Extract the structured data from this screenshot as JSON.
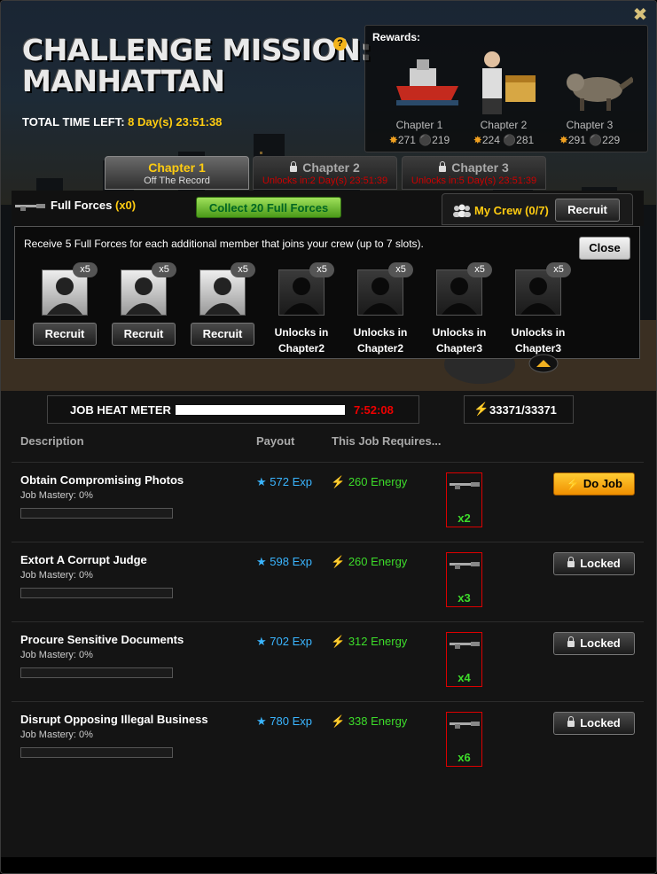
{
  "window": {
    "close_icon": "close-x-icon"
  },
  "header": {
    "title_line1": "CHALLENGE MISSION:",
    "title_line2": "MANHATTAN",
    "help_icon": "?",
    "time_left_label": "TOTAL TIME LEFT:",
    "time_left_value": "8 Day(s) 23:51:38"
  },
  "rewards": {
    "label": "Rewards:",
    "items": [
      {
        "chapter": "Chapter 1",
        "attack": "271",
        "defense": "219"
      },
      {
        "chapter": "Chapter 2",
        "attack": "224",
        "defense": "281"
      },
      {
        "chapter": "Chapter 3",
        "attack": "291",
        "defense": "229"
      }
    ]
  },
  "tabs": [
    {
      "title": "Chapter 1",
      "subtitle": "Off The Record",
      "active": true
    },
    {
      "title": "Chapter 2",
      "subtitle": "Unlocks in:2 Day(s) 23:51:39",
      "locked": true
    },
    {
      "title": "Chapter 3",
      "subtitle": "Unlocks in:5 Day(s) 23:51:39",
      "locked": true
    }
  ],
  "full_forces": {
    "label": "Full Forces",
    "count": "(x0)",
    "collect_button": "Collect 20 Full Forces"
  },
  "my_crew": {
    "label": "My Crew (0/7)",
    "recruit_button": "Recruit"
  },
  "crew_panel": {
    "message": "Receive 5 Full Forces for each additional member that joins your crew (up to 7 slots).",
    "close_button": "Close",
    "slots": [
      {
        "badge": "x5",
        "action": "Recruit",
        "unlocked": true
      },
      {
        "badge": "x5",
        "action": "Recruit",
        "unlocked": true
      },
      {
        "badge": "x5",
        "action": "Recruit",
        "unlocked": true
      },
      {
        "badge": "x5",
        "line1": "Unlocks in",
        "line2": "Chapter2"
      },
      {
        "badge": "x5",
        "line1": "Unlocks in",
        "line2": "Chapter2"
      },
      {
        "badge": "x5",
        "line1": "Unlocks in",
        "line2": "Chapter3"
      },
      {
        "badge": "x5",
        "line1": "Unlocks in",
        "line2": "Chapter3"
      }
    ]
  },
  "heat_meter": {
    "label": "JOB HEAT METER",
    "time": "7:52:08",
    "fill_fraction": 1.0
  },
  "energy": {
    "value": "33371/33371"
  },
  "columns": {
    "description": "Description",
    "payout": "Payout",
    "requires": "This Job Requires..."
  },
  "jobs": [
    {
      "name": "Obtain Compromising Photos",
      "mastery": "Job Mastery: 0%",
      "exp": "572 Exp",
      "energy": "260 Energy",
      "req_qty": "x2",
      "button": "Do Job",
      "locked": false
    },
    {
      "name": "Extort A Corrupt Judge",
      "mastery": "Job Mastery: 0%",
      "exp": "598 Exp",
      "energy": "260 Energy",
      "req_qty": "x3",
      "button": "Locked",
      "locked": true
    },
    {
      "name": "Procure Sensitive Documents",
      "mastery": "Job Mastery: 0%",
      "exp": "702 Exp",
      "energy": "312 Energy",
      "req_qty": "x4",
      "button": "Locked",
      "locked": true
    },
    {
      "name": "Disrupt Opposing Illegal Business",
      "mastery": "Job Mastery: 0%",
      "exp": "780 Exp",
      "energy": "338 Energy",
      "req_qty": "x6",
      "button": "Locked",
      "locked": true
    }
  ]
}
